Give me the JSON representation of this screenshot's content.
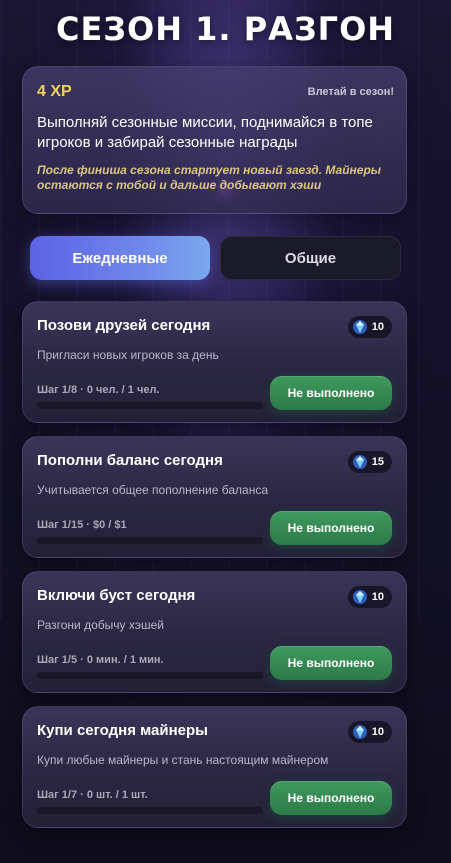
{
  "title": "СЕЗОН 1. РАЗГОН",
  "hero": {
    "xp": "4 XP",
    "tag": "Влетай в сезон!",
    "description": "Выполняй сезонные миссии, поднимайся в топе игроков и забирай сезонные награды",
    "note": "После финиша сезона стартует новый заезд. Майнеры остаются с тобой и дальше добывают хэши"
  },
  "tabs": [
    {
      "label": "Ежедневные",
      "active": true
    },
    {
      "label": "Общие",
      "active": false
    }
  ],
  "missions": [
    {
      "title": "Позови друзей сегодня",
      "reward": "10",
      "reward_icon": "gem-icon",
      "description": "Пригласи новых игроков за день",
      "step": "Шаг 1/8 · 0 чел. / 1 чел.",
      "progress": 0,
      "button": "Не выполнено"
    },
    {
      "title": "Пополни баланс сегодня",
      "reward": "15",
      "reward_icon": "gem-icon",
      "description": "Учитывается общее пополнение баланса",
      "step": "Шаг 1/15 · $0 / $1",
      "progress": 0,
      "button": "Не выполнено"
    },
    {
      "title": "Включи буст сегодня",
      "reward": "10",
      "reward_icon": "gem-icon",
      "description": "Разгони добычу хэшей",
      "step": "Шаг 1/5 · 0 мин. / 1 мин.",
      "progress": 0,
      "button": "Не выполнено"
    },
    {
      "title": "Купи сегодня майнеры",
      "reward": "10",
      "reward_icon": "gem-icon",
      "description": "Купи любые майнеры и стань настоящим майнером",
      "step": "Шаг 1/7 · 0 шт. / 1 шт.",
      "progress": 0,
      "button": "Не выполнено"
    }
  ],
  "colors": {
    "accent": "#6b7ff0",
    "xp": "#f0d35a",
    "done_button": "#3f9a5d"
  }
}
